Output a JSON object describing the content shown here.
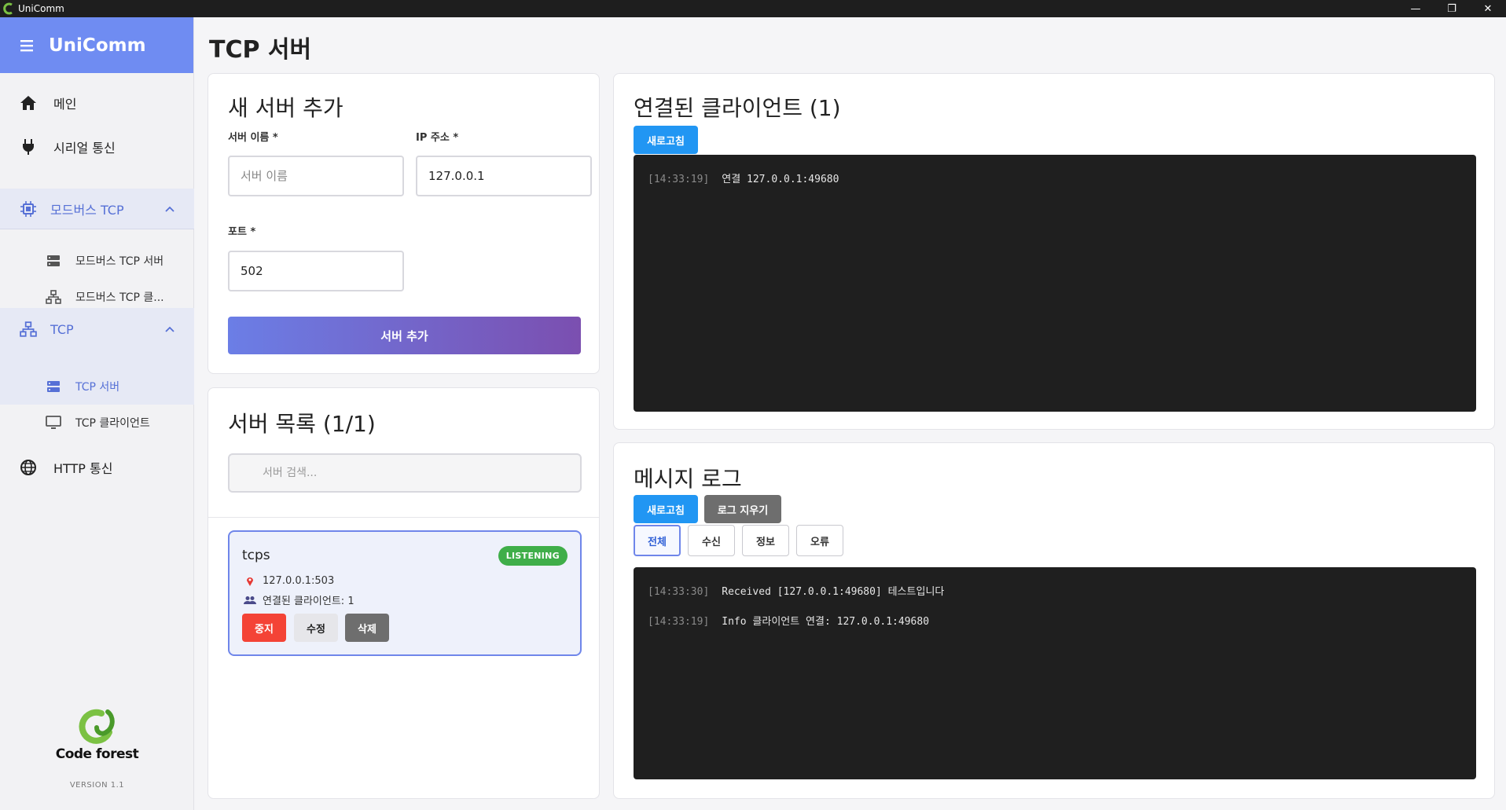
{
  "window": {
    "title": "UniComm",
    "controls": [
      "—",
      "❐",
      "✕"
    ]
  },
  "sidebar": {
    "brand": "UniComm",
    "items": [
      {
        "label": "메인",
        "icon": "home-icon"
      },
      {
        "label": "시리얼 통신",
        "icon": "plug-icon"
      },
      {
        "label": "모드버스 TCP",
        "icon": "chip-icon",
        "expanded": true,
        "children": [
          {
            "label": "모드버스 TCP 서버",
            "icon": "server-icon"
          },
          {
            "label": "모드버스 TCP 클...",
            "icon": "network-icon"
          }
        ]
      },
      {
        "label": "TCP",
        "icon": "network-icon",
        "expanded": true,
        "children": [
          {
            "label": "TCP 서버",
            "icon": "server-icon",
            "active": true
          },
          {
            "label": "TCP 클라이언트",
            "icon": "monitor-icon"
          }
        ]
      },
      {
        "label": "HTTP 통신",
        "icon": "globe-icon"
      }
    ],
    "footer": {
      "company": "Code forest",
      "version": "VERSION 1.1"
    }
  },
  "page": {
    "title": "TCP 서버"
  },
  "add_server": {
    "title": "새 서버 추가",
    "name_label": "서버 이름 *",
    "name_placeholder": "서버 이름",
    "name_value": "",
    "ip_label": "IP 주소 *",
    "ip_value": "127.0.0.1",
    "port_label": "포트 *",
    "port_value": "502",
    "submit_label": "서버 추가"
  },
  "server_list": {
    "title": "서버 목록 (1/1)",
    "search_placeholder": "서버 검색...",
    "servers": [
      {
        "name": "tcps",
        "status": "LISTENING",
        "address": "127.0.0.1:503",
        "clients_text": "연결된 클라이언트: 1",
        "buttons": {
          "stop": "중지",
          "edit": "수정",
          "delete": "삭제"
        }
      }
    ]
  },
  "clients": {
    "title": "연결된 클라이언트 (1)",
    "refresh_label": "새로고침",
    "entries": [
      {
        "time": "[14:33:19]",
        "text": "연결 127.0.0.1:49680"
      }
    ]
  },
  "messages": {
    "title": "메시지 로그",
    "refresh_label": "새로고침",
    "clear_label": "로그 지우기",
    "filters": [
      "전체",
      "수신",
      "정보",
      "오류"
    ],
    "active_filter": "전체",
    "entries": [
      {
        "time": "[14:33:30]",
        "text": "Received [127.0.0.1:49680] 테스트입니다"
      },
      {
        "time": "[14:33:19]",
        "text": "Info 클라이언트 연결: 127.0.0.1:49680"
      }
    ]
  },
  "colors": {
    "accent": "#6f8cf2",
    "status_listening": "#3fae49",
    "stop": "#f44336",
    "refresh": "#2196f3"
  }
}
